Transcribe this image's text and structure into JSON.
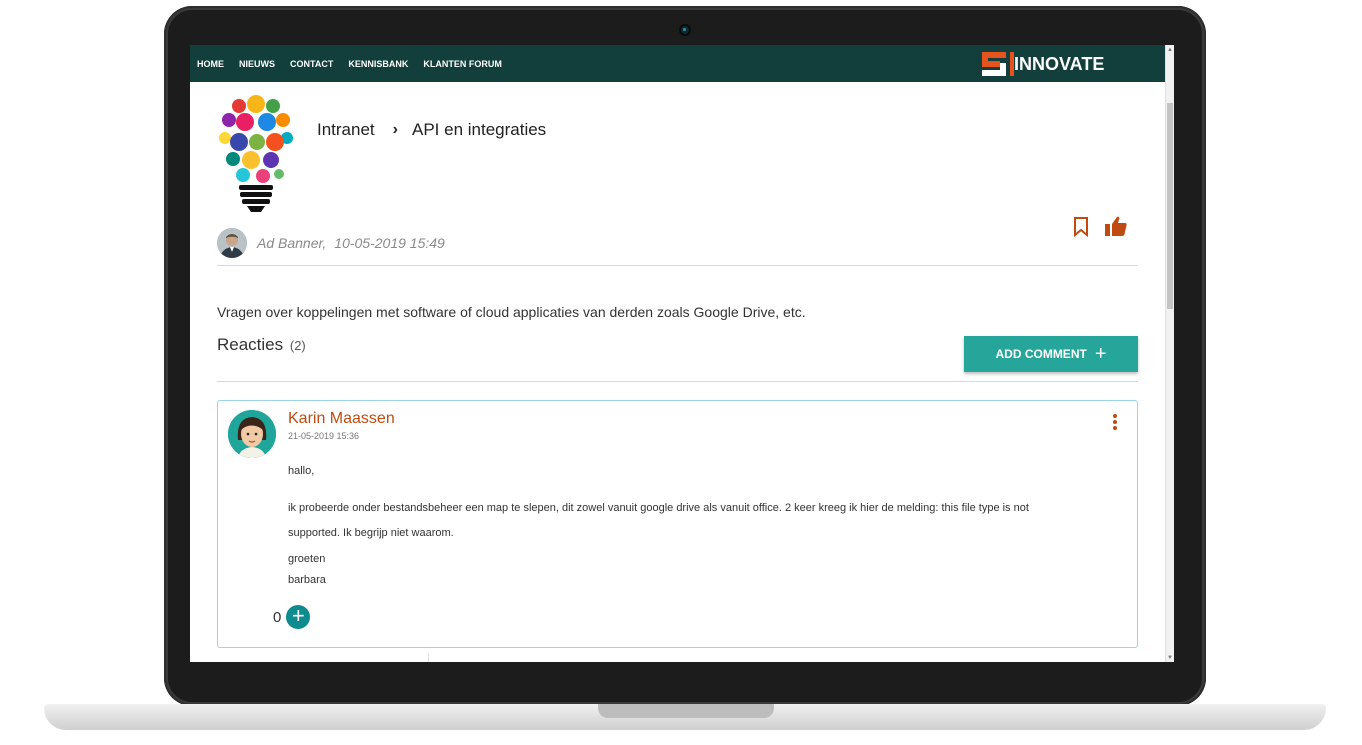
{
  "nav": {
    "items": [
      "HOME",
      "NIEUWS",
      "CONTACT",
      "KENNISBANK",
      "KLANTEN FORUM"
    ],
    "logo_text": "INNOVATE"
  },
  "breadcrumb": {
    "root": "Intranet",
    "current": "API en integraties"
  },
  "post": {
    "author": "Ad Banner,",
    "date": "10-05-2019 15:49",
    "description": "Vragen over koppelingen met software of cloud applicaties van derden zoals Google Drive, etc."
  },
  "comments_header": {
    "label": "Reacties",
    "count": "(2)",
    "add_button": "ADD COMMENT",
    "add_button_icon": "+"
  },
  "comment": {
    "author": "Karin Maassen",
    "date": "21-05-2019 15:36",
    "greeting": "hallo,",
    "body_line1": "ik probeerde onder bestandsbeheer een map te slepen, dit zowel vanuit google drive als vanuit office. 2 keer kreeg ik hier de melding: this file type is not",
    "body_line2": "supported. Ik begrijp niet waarom.",
    "closing1": "groeten",
    "closing2": "barbara",
    "votes": "0",
    "vote_icon": "+"
  },
  "icons": [
    "innovate-logo-icon",
    "lightbulb-icon",
    "bookmark-icon",
    "thumbs-up-icon",
    "more-vert-icon",
    "plus-icon",
    "avatar"
  ],
  "colors": {
    "navbar": "#123f3b",
    "accent_teal": "#26a69a",
    "accent_orange": "#bf4b12",
    "vote_button": "#0d8b8f",
    "card_border": "#9ed3e6"
  }
}
